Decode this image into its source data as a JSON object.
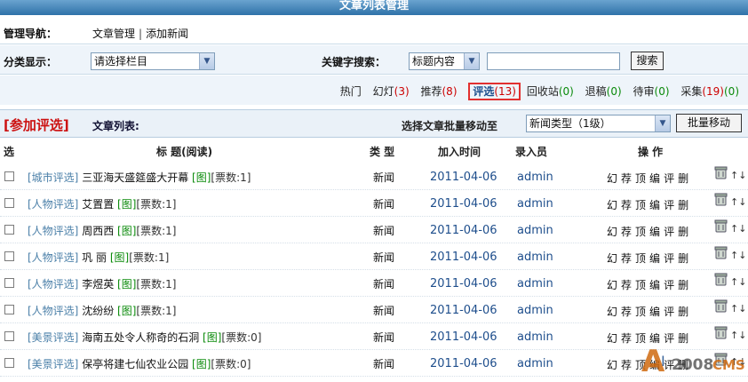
{
  "header": {
    "title": "文章列表管理"
  },
  "nav": {
    "label": "管理导航：",
    "links": [
      "文章管理",
      "添加新闻"
    ],
    "sep": "|"
  },
  "filter": {
    "category_label": "分类显示：",
    "category_select": "请选择栏目",
    "keyword_label": "关键字搜索：",
    "field_select": "标题内容",
    "search_value": "",
    "search_button": "搜索"
  },
  "categories": {
    "hot": "热门",
    "slide": {
      "label": "幻灯",
      "count": "(3)"
    },
    "recommend": {
      "label": "推荐",
      "count": "(8)"
    },
    "review": {
      "label": "评选",
      "count": "(13)"
    },
    "recycle": {
      "label": "回收站",
      "count": "(0)"
    },
    "rejected": {
      "label": "退稿",
      "count": "(0)"
    },
    "pending": {
      "label": "待审",
      "count": "(0)"
    },
    "collect": {
      "label": "采集",
      "count": "(19)",
      "count2": "(0)"
    }
  },
  "list": {
    "tag": "[参加评选]",
    "title": "文章列表:",
    "batch_label": "选择文章批量移动至",
    "batch_select": "新闻类型（1级）",
    "batch_button": "批量移动"
  },
  "columns": {
    "select": "选",
    "title": "标 题(阅读)",
    "type": "类 型",
    "date": "加入时间",
    "user": "录入员",
    "ops": "操 作"
  },
  "ops": [
    "幻",
    "荐",
    "顶",
    "编",
    "评",
    "删"
  ],
  "rows": [
    {
      "cat": "[城市评选]",
      "name": "三亚海天盛筵盛大开幕",
      "img": "[图]",
      "votes": "[票数:1]",
      "type": "新闻",
      "date": "2011-04-06",
      "user": "admin"
    },
    {
      "cat": "[人物评选]",
      "name": "艾置置",
      "img": "[图]",
      "votes": "[票数:1]",
      "type": "新闻",
      "date": "2011-04-06",
      "user": "admin"
    },
    {
      "cat": "[人物评选]",
      "name": "周西西",
      "img": "[图]",
      "votes": "[票数:1]",
      "type": "新闻",
      "date": "2011-04-06",
      "user": "admin"
    },
    {
      "cat": "[人物评选]",
      "name": "巩 丽",
      "img": "[图]",
      "votes": "[票数:1]",
      "type": "新闻",
      "date": "2011-04-06",
      "user": "admin"
    },
    {
      "cat": "[人物评选]",
      "name": "李煜英",
      "img": "[图]",
      "votes": "[票数:1]",
      "type": "新闻",
      "date": "2011-04-06",
      "user": "admin"
    },
    {
      "cat": "[人物评选]",
      "name": "沈纷纷",
      "img": "[图]",
      "votes": "[票数:1]",
      "type": "新闻",
      "date": "2011-04-06",
      "user": "admin"
    },
    {
      "cat": "[美景评选]",
      "name": "海南五处令人称奇的石洞",
      "img": "[图]",
      "votes": "[票数:0]",
      "type": "新闻",
      "date": "2011-04-06",
      "user": "admin"
    },
    {
      "cat": "[美景评选]",
      "name": "保亭将建七仙农业公园",
      "img": "[图]",
      "votes": "[票数:0]",
      "type": "新闻",
      "date": "2011-04-06",
      "user": "admin"
    }
  ],
  "watermark": {
    "text": "AI 2008 CMS"
  },
  "colors": {
    "accent": "#2f72a8",
    "active_border": "#e23030",
    "count_red": "#cc0000",
    "link_blue": "#1e4e8c"
  }
}
